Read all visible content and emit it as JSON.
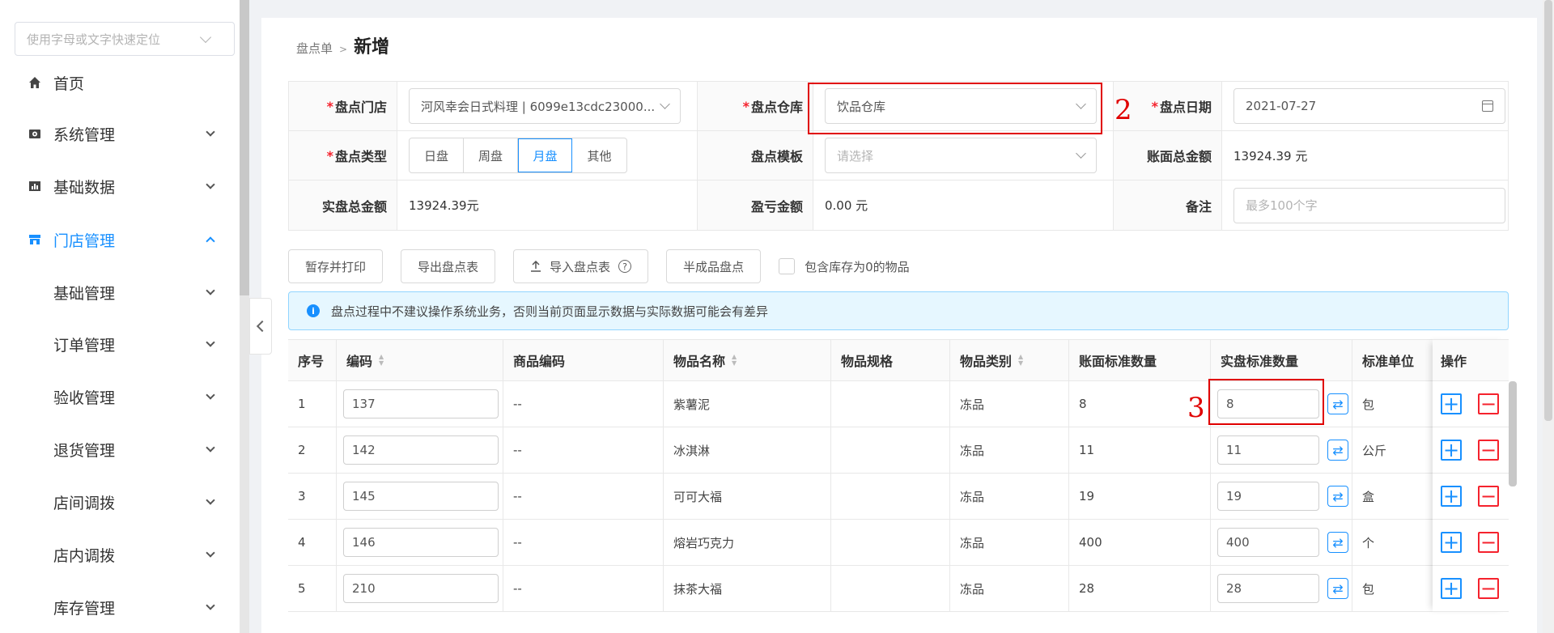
{
  "sidebar": {
    "search_placeholder": "使用字母或文字快速定位",
    "items": [
      {
        "label": "首页"
      },
      {
        "label": "系统管理"
      },
      {
        "label": "基础数据"
      },
      {
        "label": "门店管理"
      },
      {
        "label": "基础管理"
      },
      {
        "label": "订单管理"
      },
      {
        "label": "验收管理"
      },
      {
        "label": "退货管理"
      },
      {
        "label": "店间调拨"
      },
      {
        "label": "店内调拨"
      },
      {
        "label": "库存管理"
      }
    ]
  },
  "breadcrumb": {
    "parent": "盘点单",
    "separator": ">",
    "current": "新增"
  },
  "form": {
    "store_label": "盘点门店",
    "store_value": "河风幸会日式料理 | 6099e13cdc23000...",
    "warehouse_label": "盘点仓库",
    "warehouse_value": "饮品仓库",
    "date_label": "盘点日期",
    "date_value": "2021-07-27",
    "type_label": "盘点类型",
    "type_options": [
      "日盘",
      "周盘",
      "月盘",
      "其他"
    ],
    "type_selected": "月盘",
    "template_label": "盘点模板",
    "template_placeholder": "请选择",
    "book_total_label": "账面总金额",
    "book_total_value": "13924.39 元",
    "actual_total_label": "实盘总金额",
    "actual_total_value": "13924.39元",
    "profit_loss_label": "盈亏金额",
    "profit_loss_value": "0.00 元",
    "remark_label": "备注",
    "remark_placeholder": "最多100个字"
  },
  "toolbar": {
    "save_print": "暂存并打印",
    "export": "导出盘点表",
    "import": "导入盘点表",
    "import_help": "?",
    "semi_finished": "半成品盘点",
    "include_zero": "包含库存为0的物品"
  },
  "alert": {
    "icon": "info-icon",
    "text": "盘点过程中不建议操作系统业务，否则当前页面显示数据与实际数据可能会有差异"
  },
  "table": {
    "headers": {
      "index": "序号",
      "code": "编码",
      "product_code": "商品编码",
      "name": "物品名称",
      "spec": "物品规格",
      "category": "物品类别",
      "book_qty": "账面标准数量",
      "actual_qty": "实盘标准数量",
      "unit": "标准单位",
      "ops": "操作"
    },
    "rows": [
      {
        "index": "1",
        "code": "137",
        "product_code": "--",
        "name": "紫薯泥",
        "spec": "",
        "category": "冻品",
        "book_qty": "8",
        "actual_qty": "8",
        "unit": "包"
      },
      {
        "index": "2",
        "code": "142",
        "product_code": "--",
        "name": "冰淇淋",
        "spec": "",
        "category": "冻品",
        "book_qty": "11",
        "actual_qty": "11",
        "unit": "公斤"
      },
      {
        "index": "3",
        "code": "145",
        "product_code": "--",
        "name": "可可大福",
        "spec": "",
        "category": "冻品",
        "book_qty": "19",
        "actual_qty": "19",
        "unit": "盒"
      },
      {
        "index": "4",
        "code": "146",
        "product_code": "--",
        "name": "熔岩巧克力",
        "spec": "",
        "category": "冻品",
        "book_qty": "400",
        "actual_qty": "400",
        "unit": "个"
      },
      {
        "index": "5",
        "code": "210",
        "product_code": "--",
        "name": "抹茶大福",
        "spec": "",
        "category": "冻品",
        "book_qty": "28",
        "actual_qty": "28",
        "unit": "包"
      }
    ],
    "plus_symbol": "+",
    "minus_symbol": "−"
  },
  "annotations": {
    "num2": "2",
    "num3": "3"
  },
  "colors": {
    "accent": "#1890ff",
    "danger": "#f5222d",
    "annotation": "#e00000"
  }
}
